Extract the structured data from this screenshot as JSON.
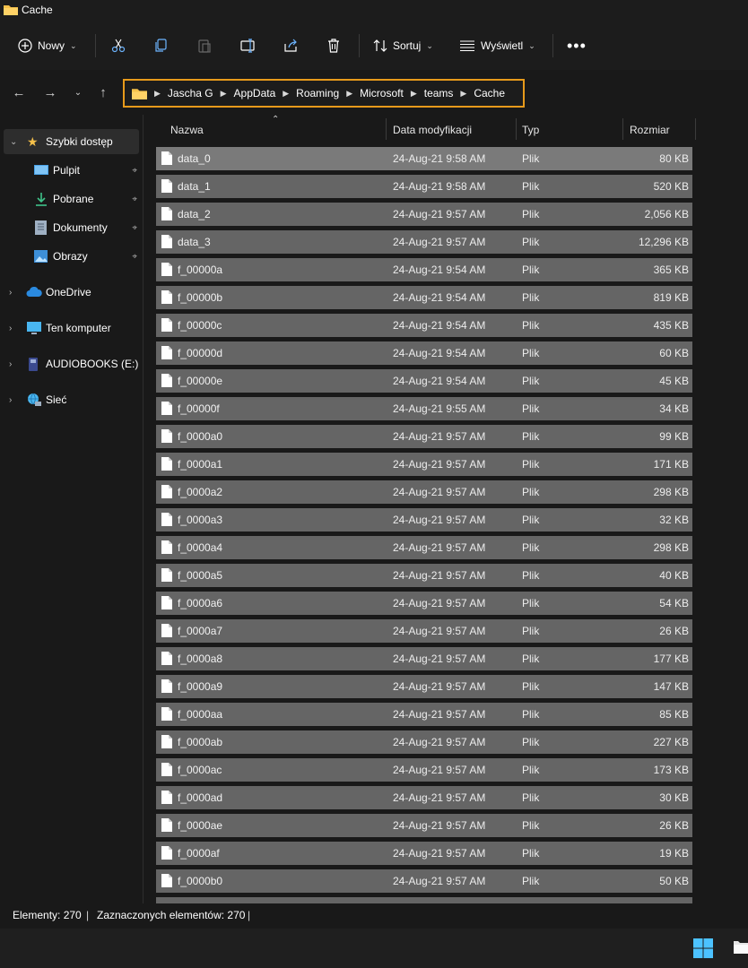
{
  "window": {
    "title": "Cache"
  },
  "toolbar": {
    "new_label": "Nowy",
    "sort_label": "Sortuj",
    "view_label": "Wyświetl"
  },
  "breadcrumb": [
    "Jascha G",
    "AppData",
    "Roaming",
    "Microsoft",
    "teams",
    "Cache"
  ],
  "sidebar": {
    "quick_access": "Szybki dostęp",
    "pinned": [
      {
        "label": "Pulpit",
        "icon": "desktop-icon"
      },
      {
        "label": "Pobrane",
        "icon": "download-icon"
      },
      {
        "label": "Dokumenty",
        "icon": "documents-icon"
      },
      {
        "label": "Obrazy",
        "icon": "pictures-icon"
      }
    ],
    "roots": [
      {
        "label": "OneDrive",
        "icon": "cloud-icon"
      },
      {
        "label": "Ten komputer",
        "icon": "computer-icon"
      },
      {
        "label": "AUDIOBOOKS (E:)",
        "icon": "drive-icon"
      },
      {
        "label": "Sieć",
        "icon": "network-icon"
      }
    ]
  },
  "columns": {
    "name": "Nazwa",
    "date": "Data modyfikacji",
    "type": "Typ",
    "size": "Rozmiar"
  },
  "files": [
    {
      "name": "data_0",
      "date": "24-Aug-21 9:58 AM",
      "type": "Plik",
      "size": "80 KB"
    },
    {
      "name": "data_1",
      "date": "24-Aug-21 9:58 AM",
      "type": "Plik",
      "size": "520 KB"
    },
    {
      "name": "data_2",
      "date": "24-Aug-21 9:57 AM",
      "type": "Plik",
      "size": "2,056 KB"
    },
    {
      "name": "data_3",
      "date": "24-Aug-21 9:57 AM",
      "type": "Plik",
      "size": "12,296 KB"
    },
    {
      "name": "f_00000a",
      "date": "24-Aug-21 9:54 AM",
      "type": "Plik",
      "size": "365 KB"
    },
    {
      "name": "f_00000b",
      "date": "24-Aug-21 9:54 AM",
      "type": "Plik",
      "size": "819 KB"
    },
    {
      "name": "f_00000c",
      "date": "24-Aug-21 9:54 AM",
      "type": "Plik",
      "size": "435 KB"
    },
    {
      "name": "f_00000d",
      "date": "24-Aug-21 9:54 AM",
      "type": "Plik",
      "size": "60 KB"
    },
    {
      "name": "f_00000e",
      "date": "24-Aug-21 9:54 AM",
      "type": "Plik",
      "size": "45 KB"
    },
    {
      "name": "f_00000f",
      "date": "24-Aug-21 9:55 AM",
      "type": "Plik",
      "size": "34 KB"
    },
    {
      "name": "f_0000a0",
      "date": "24-Aug-21 9:57 AM",
      "type": "Plik",
      "size": "99 KB"
    },
    {
      "name": "f_0000a1",
      "date": "24-Aug-21 9:57 AM",
      "type": "Plik",
      "size": "171 KB"
    },
    {
      "name": "f_0000a2",
      "date": "24-Aug-21 9:57 AM",
      "type": "Plik",
      "size": "298 KB"
    },
    {
      "name": "f_0000a3",
      "date": "24-Aug-21 9:57 AM",
      "type": "Plik",
      "size": "32 KB"
    },
    {
      "name": "f_0000a4",
      "date": "24-Aug-21 9:57 AM",
      "type": "Plik",
      "size": "298 KB"
    },
    {
      "name": "f_0000a5",
      "date": "24-Aug-21 9:57 AM",
      "type": "Plik",
      "size": "40 KB"
    },
    {
      "name": "f_0000a6",
      "date": "24-Aug-21 9:57 AM",
      "type": "Plik",
      "size": "54 KB"
    },
    {
      "name": "f_0000a7",
      "date": "24-Aug-21 9:57 AM",
      "type": "Plik",
      "size": "26 KB"
    },
    {
      "name": "f_0000a8",
      "date": "24-Aug-21 9:57 AM",
      "type": "Plik",
      "size": "177 KB"
    },
    {
      "name": "f_0000a9",
      "date": "24-Aug-21 9:57 AM",
      "type": "Plik",
      "size": "147 KB"
    },
    {
      "name": "f_0000aa",
      "date": "24-Aug-21 9:57 AM",
      "type": "Plik",
      "size": "85 KB"
    },
    {
      "name": "f_0000ab",
      "date": "24-Aug-21 9:57 AM",
      "type": "Plik",
      "size": "227 KB"
    },
    {
      "name": "f_0000ac",
      "date": "24-Aug-21 9:57 AM",
      "type": "Plik",
      "size": "173 KB"
    },
    {
      "name": "f_0000ad",
      "date": "24-Aug-21 9:57 AM",
      "type": "Plik",
      "size": "30 KB"
    },
    {
      "name": "f_0000ae",
      "date": "24-Aug-21 9:57 AM",
      "type": "Plik",
      "size": "26 KB"
    },
    {
      "name": "f_0000af",
      "date": "24-Aug-21 9:57 AM",
      "type": "Plik",
      "size": "19 KB"
    },
    {
      "name": "f_0000b0",
      "date": "24-Aug-21 9:57 AM",
      "type": "Plik",
      "size": "50 KB"
    }
  ],
  "status": {
    "count": "Elementy: 270",
    "selected": "Zaznaczonych elementów: 270"
  },
  "colors": {
    "accent_highlight": "#e79a1b",
    "selection": "#656565",
    "folder": "#f5c04a"
  }
}
